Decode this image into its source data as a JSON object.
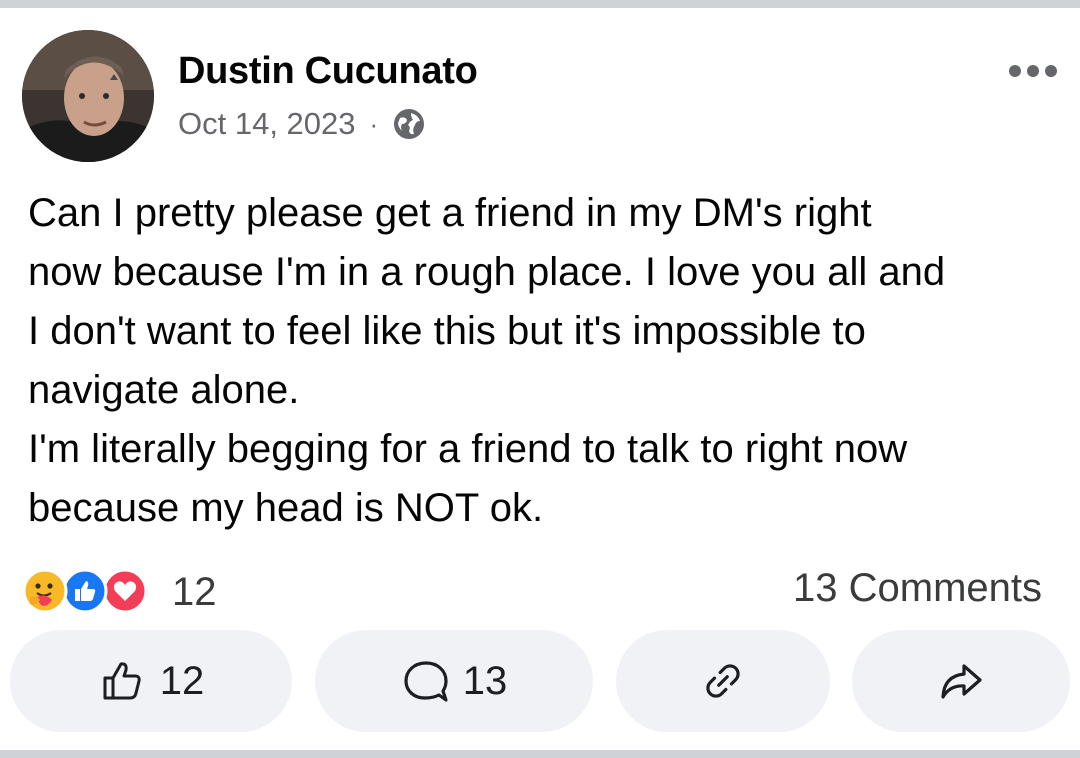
{
  "post": {
    "author": "Dustin Cucunato",
    "date": "Oct 14, 2023",
    "separator": "·",
    "privacy_icon": "globe-icon",
    "more_icon": "more-options-icon",
    "text_lines": [
      "Can I pretty please get a friend in my DM's right",
      "now because I'm in a rough place. I love you all and",
      "I don't want to feel like this but it's impossible to",
      "navigate alone.",
      "I'm literally begging for a friend to talk to right now",
      "because my head is NOT ok."
    ]
  },
  "reactions": {
    "icons": [
      "care-reaction-icon",
      "like-reaction-icon",
      "love-reaction-icon"
    ],
    "count": "12",
    "comments_label": "13 Comments"
  },
  "actions": {
    "like_count": "12",
    "comment_count": "13",
    "copy_link_icon": "link-icon",
    "share_icon": "share-icon"
  },
  "colors": {
    "like_blue": "#1877f2",
    "love_red": "#f33e58",
    "care_yellow": "#f7b928",
    "secondary_text": "#65676b",
    "button_bg": "#f0f2f5"
  }
}
